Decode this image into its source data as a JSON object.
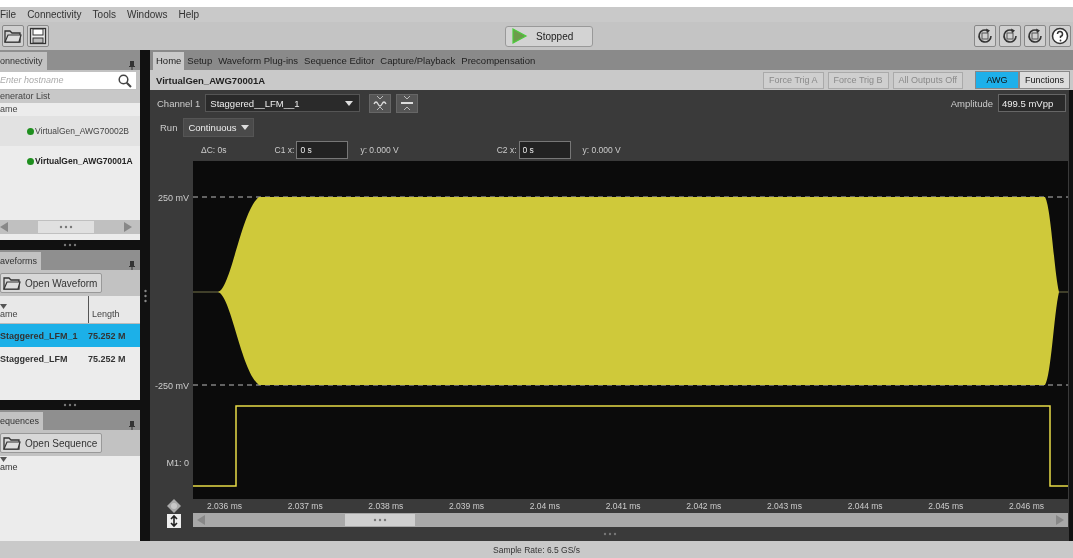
{
  "menu": [
    "File",
    "Connectivity",
    "Tools",
    "Windows",
    "Help"
  ],
  "toolbar": {
    "run_button": "Stopped"
  },
  "connectivity": {
    "tab": "onnectivity",
    "search": {
      "placeholder": "Enter hostname"
    },
    "section": "enerator List",
    "column": "ame",
    "generators": [
      {
        "name": "VirtualGen_AWG70002B",
        "selected": false
      },
      {
        "name": "VirtualGen_AWG70001A",
        "selected": true
      }
    ]
  },
  "waveforms": {
    "tab": "aveforms",
    "open_button": "Open Waveform",
    "columns": [
      "ame",
      "Length"
    ],
    "rows": [
      {
        "name": "Staggered_LFM_1",
        "length": "75.252 M",
        "selected": true
      },
      {
        "name": "Staggered_LFM",
        "length": "75.252 M",
        "selected": false
      }
    ]
  },
  "sequences": {
    "tab": "equences",
    "open_button": "Open Sequence",
    "columns": [
      "ame"
    ]
  },
  "tabs": [
    {
      "label": "Home",
      "selected": true
    },
    {
      "label": "Setup",
      "selected": false
    },
    {
      "label": "Waveform Plug-ins",
      "selected": false
    },
    {
      "label": "Sequence Editor",
      "selected": false
    },
    {
      "label": "Capture/Playback",
      "selected": false
    },
    {
      "label": "Precompensation",
      "selected": false
    }
  ],
  "instrument": {
    "name": "VirtualGen_AWG70001A",
    "buttons": [
      {
        "label": "Force Trig A",
        "disabled": true
      },
      {
        "label": "Force Trig B",
        "disabled": true
      },
      {
        "label": "All Outputs Off",
        "disabled": true
      }
    ],
    "modes": [
      {
        "label": "AWG",
        "selected": true
      },
      {
        "label": "Functions",
        "selected": false
      }
    ]
  },
  "channel": {
    "label": "Channel 1",
    "waveform": "Staggered__LFM__1",
    "amplitude_label": "Amplitude",
    "amplitude": "499.5 mVpp"
  },
  "run": {
    "label": "Run",
    "mode": "Continuous"
  },
  "cursors": {
    "delta": "ΔC: 0s",
    "c1_label": "C1 x:",
    "c1_x": "0 s",
    "c1_y": "y: 0.000 V",
    "c2_label": "C2 x:",
    "c2_x": "0 s",
    "c2_y": "y: 0.000 V"
  },
  "plot": {
    "y_labels": [
      "250 mV",
      "-250 mV"
    ],
    "marker_label": "M1: 0",
    "x_ticks": [
      "2.036 ms",
      "2.037 ms",
      "2.038 ms",
      "2.039 ms",
      "2.04 ms",
      "2.041 ms",
      "2.042 ms",
      "2.043 ms",
      "2.044 ms",
      "2.045 ms",
      "2.046 ms"
    ]
  },
  "status_bar": "Sample Rate: 6.5 GS/s"
}
